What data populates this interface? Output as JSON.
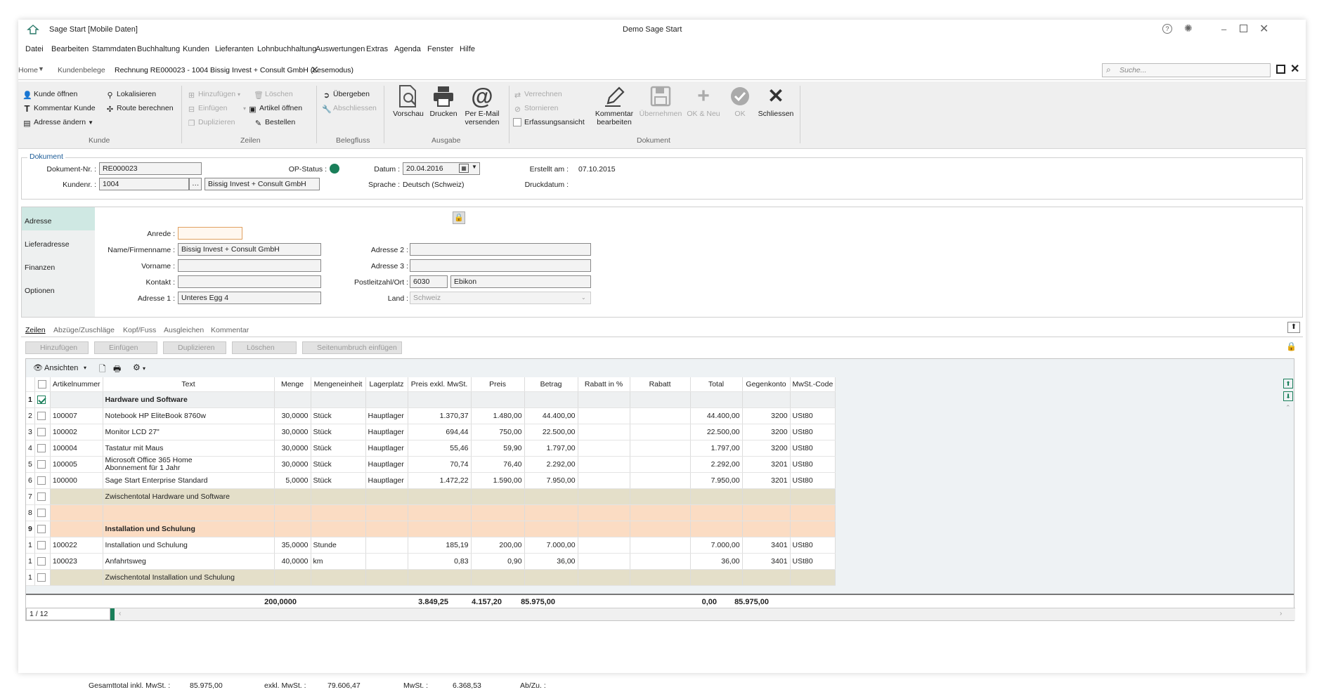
{
  "window": {
    "app_title": "Sage Start [Mobile Daten]",
    "center_title": "Demo Sage Start"
  },
  "menu": [
    "Datei",
    "Bearbeiten",
    "Stammdaten",
    "Buchhaltung",
    "Kunden",
    "Lieferanten",
    "Lohnbuchhaltung",
    "Auswertungen",
    "Extras",
    "Agenda",
    "Fenster",
    "Hilfe"
  ],
  "tabs": {
    "home": "Home",
    "kundenbelege": "Kundenbelege",
    "active": "Rechnung RE000023 - 1004 Bissig Invest + Consult GmbH (Lesemodus)"
  },
  "search": {
    "placeholder": "Suche..."
  },
  "ribbon": {
    "kunde": {
      "kunde_oeffnen": "Kunde öffnen",
      "kommentar_kunde": "Kommentar Kunde",
      "adresse_aendern": "Adresse ändern",
      "lokalisieren": "Lokalisieren",
      "route_berechnen": "Route berechnen",
      "label": "Kunde"
    },
    "zeilen": {
      "hinzufuegen": "Hinzufügen",
      "einfuegen": "Einfügen",
      "duplizieren": "Duplizieren",
      "loeschen": "Löschen",
      "artikel_oeffnen": "Artikel öffnen",
      "bestellen": "Bestellen",
      "label": "Zeilen"
    },
    "belegfluss": {
      "uebergeben": "Übergeben",
      "abschliessen": "Abschliessen",
      "label": "Belegfluss"
    },
    "ausgabe": {
      "vorschau": "Vorschau",
      "drucken": "Drucken",
      "email_1": "Per E-Mail",
      "email_2": "versenden",
      "label": "Ausgabe"
    },
    "dokument": {
      "verrechnen": "Verrechnen",
      "stornieren": "Stornieren",
      "erfassungsansicht": "Erfassungsansicht",
      "kommentar_1": "Kommentar",
      "kommentar_2": "bearbeiten",
      "uebernehmen": "Übernehmen",
      "ok_neu": "OK & Neu",
      "ok": "OK",
      "schliessen": "Schliessen",
      "label": "Dokument"
    }
  },
  "dokument": {
    "legend": "Dokument",
    "dokument_nr_label": "Dokument-Nr. :",
    "dokument_nr": "RE000023",
    "kundennr_label": "Kundenr. :",
    "kundennr": "1004",
    "kunde_name": "Bissig Invest + Consult GmbH",
    "op_status_label": "OP-Status :",
    "datum_label": "Datum :",
    "datum": "20.04.2016",
    "sprache_label": "Sprache :",
    "sprache": "Deutsch (Schweiz)",
    "erstellt_label": "Erstellt am :",
    "erstellt": "07.10.2015",
    "druckdatum_label": "Druckdatum :"
  },
  "sidebar": [
    "Adresse",
    "Lieferadresse",
    "Finanzen",
    "Optionen"
  ],
  "adresse": {
    "anrede_label": "Anrede :",
    "anrede": "",
    "name_label": "Name/Firmenname :",
    "name": "Bissig Invest + Consult GmbH",
    "vorname_label": "Vorname :",
    "vorname": "",
    "kontakt_label": "Kontakt :",
    "kontakt": "",
    "adresse1_label": "Adresse 1 :",
    "adresse1": "Unteres Egg 4",
    "adresse2_label": "Adresse 2 :",
    "adresse2": "",
    "adresse3_label": "Adresse 3 :",
    "adresse3": "",
    "plz_label": "Postleitzahl/Ort :",
    "plz": "6030",
    "ort": "Ebikon",
    "land_label": "Land :",
    "land": "Schweiz"
  },
  "subtabs": [
    "Zeilen",
    "Abzüge/Zuschläge",
    "Kopf/Fuss",
    "Ausgleichen",
    "Kommentar"
  ],
  "gridtools": [
    "Hinzufügen",
    "Einfügen",
    "Duplizieren",
    "Löschen",
    "Seitenumbruch einfügen"
  ],
  "grid": {
    "ansichten": "Ansichten",
    "columns": [
      "",
      "Artikelnummer",
      "Text",
      "Menge",
      "Mengeneinheit",
      "Lagerplatz",
      "Preis exkl. MwSt.",
      "Preis",
      "Betrag",
      "Rabatt in %",
      "Rabatt",
      "Total",
      "Gegenkonto",
      "MwSt.-Code"
    ],
    "rows": [
      {
        "idx": "1",
        "checked": true,
        "type": "header",
        "cells": [
          "",
          "Hardware und Software",
          "",
          "",
          "",
          "",
          "",
          "",
          "",
          "",
          "",
          "",
          ""
        ]
      },
      {
        "idx": "2",
        "checked": false,
        "type": "item",
        "cells": [
          "100007",
          "Notebook HP EliteBook 8760w",
          "30,0000",
          "Stück",
          "Hauptlager",
          "1.370,37",
          "1.480,00",
          "44.400,00",
          "",
          "",
          "44.400,00",
          "3200",
          "USt80"
        ]
      },
      {
        "idx": "3",
        "checked": false,
        "type": "item",
        "cells": [
          "100002",
          "Monitor LCD 27\"",
          "30,0000",
          "Stück",
          "Hauptlager",
          "694,44",
          "750,00",
          "22.500,00",
          "",
          "",
          "22.500,00",
          "3200",
          "USt80"
        ]
      },
      {
        "idx": "4",
        "checked": false,
        "type": "item",
        "cells": [
          "100004",
          "Tastatur mit Maus",
          "30,0000",
          "Stück",
          "Hauptlager",
          "55,46",
          "59,90",
          "1.797,00",
          "",
          "",
          "1.797,00",
          "3200",
          "USt80"
        ]
      },
      {
        "idx": "5",
        "checked": false,
        "type": "item2",
        "cells": [
          "100005",
          "Microsoft Office 365 Home",
          "30,0000",
          "Stück",
          "Hauptlager",
          "70,74",
          "76,40",
          "2.292,00",
          "",
          "",
          "2.292,00",
          "3201",
          "USt80"
        ],
        "text2": "Abonnement für 1 Jahr"
      },
      {
        "idx": "6",
        "checked": false,
        "type": "item",
        "cells": [
          "100000",
          "Sage Start Enterprise Standard",
          "5,0000",
          "Stück",
          "Hauptlager",
          "1.472,22",
          "1.590,00",
          "7.950,00",
          "",
          "",
          "7.950,00",
          "3201",
          "USt80"
        ]
      },
      {
        "idx": "7",
        "checked": false,
        "type": "subtotal",
        "cells": [
          "",
          "Zwischentotal Hardware und Software",
          "",
          "",
          "",
          "",
          "",
          "",
          "",
          "",
          "",
          "",
          ""
        ]
      },
      {
        "idx": "8",
        "checked": false,
        "type": "break",
        "cells": [
          "",
          "",
          "",
          "",
          "",
          "",
          "",
          "",
          "",
          "",
          "",
          "",
          ""
        ]
      },
      {
        "idx": "9",
        "checked": false,
        "type": "header2",
        "cells": [
          "",
          "Installation und Schulung",
          "",
          "",
          "",
          "",
          "",
          "",
          "",
          "",
          "",
          "",
          ""
        ]
      },
      {
        "idx": "1",
        "checked": false,
        "type": "item",
        "cells": [
          "100022",
          "Installation und Schulung",
          "35,0000",
          "Stunde",
          "",
          "185,19",
          "200,00",
          "7.000,00",
          "",
          "",
          "7.000,00",
          "3401",
          "USt80"
        ]
      },
      {
        "idx": "1",
        "checked": false,
        "type": "item",
        "cells": [
          "100023",
          "Anfahrtsweg",
          "40,0000",
          "km",
          "",
          "0,83",
          "0,90",
          "36,00",
          "",
          "",
          "36,00",
          "3401",
          "USt80"
        ]
      },
      {
        "idx": "1",
        "checked": false,
        "type": "subtotal",
        "cells": [
          "",
          "Zwischentotal Installation und Schulung",
          "",
          "",
          "",
          "",
          "",
          "",
          "",
          "",
          "",
          "",
          ""
        ]
      }
    ],
    "totals": {
      "menge": "200,0000",
      "preis_exkl": "3.849,25",
      "preis": "4.157,20",
      "betrag": "85.975,00",
      "rabatt": "0,00",
      "total": "85.975,00"
    },
    "pager": "1 / 12"
  },
  "footer": {
    "gesamttotal_label": "Gesamttotal inkl. MwSt. :",
    "gesamttotal": "85.975,00",
    "exkl_label": "exkl. MwSt. :",
    "exkl": "79.606,47",
    "mwst_label": "MwSt. :",
    "mwst": "6.368,53",
    "abzu_label": "Ab/Zu. :"
  },
  "colors": {
    "accent": "#1a7f5a",
    "subtotal_row": "#e4dfc9",
    "break_row": "#fbdcc3",
    "sidebar_active": "#cfe8e3"
  }
}
